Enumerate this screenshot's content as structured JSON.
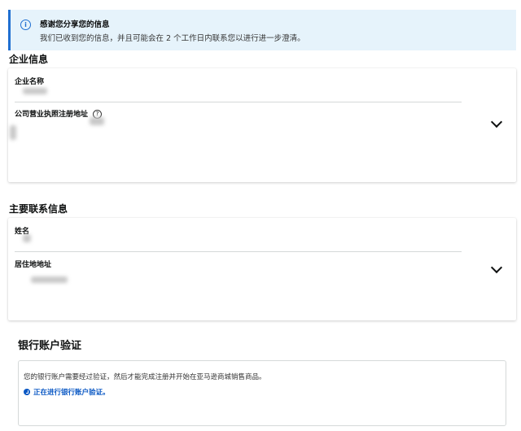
{
  "banner": {
    "icon": "info-icon",
    "title": "感谢您分享您的信息",
    "text": "我们已收到您的信息，并且可能会在 2 个工作日内联系您以进行进一步澄清。"
  },
  "business": {
    "section_title": "企业信息",
    "name_label": "企业名称",
    "address_label": "公司营业执照注册地址",
    "help_icon": "question-circle-icon",
    "expand_icon": "chevron-down-icon"
  },
  "contact": {
    "section_title": "主要联系信息",
    "name_label": "姓名",
    "address_label": "居住地地址",
    "expand_icon": "chevron-down-icon"
  },
  "bank": {
    "section_title": "银行账户验证",
    "description": "您的银行账户需要经过验证，然后才能完成注册并开始在亚马逊商城销售商品。",
    "status_icon": "clock-icon",
    "status": "正在进行银行账户验证。",
    "status_color": "#0a58c4"
  }
}
